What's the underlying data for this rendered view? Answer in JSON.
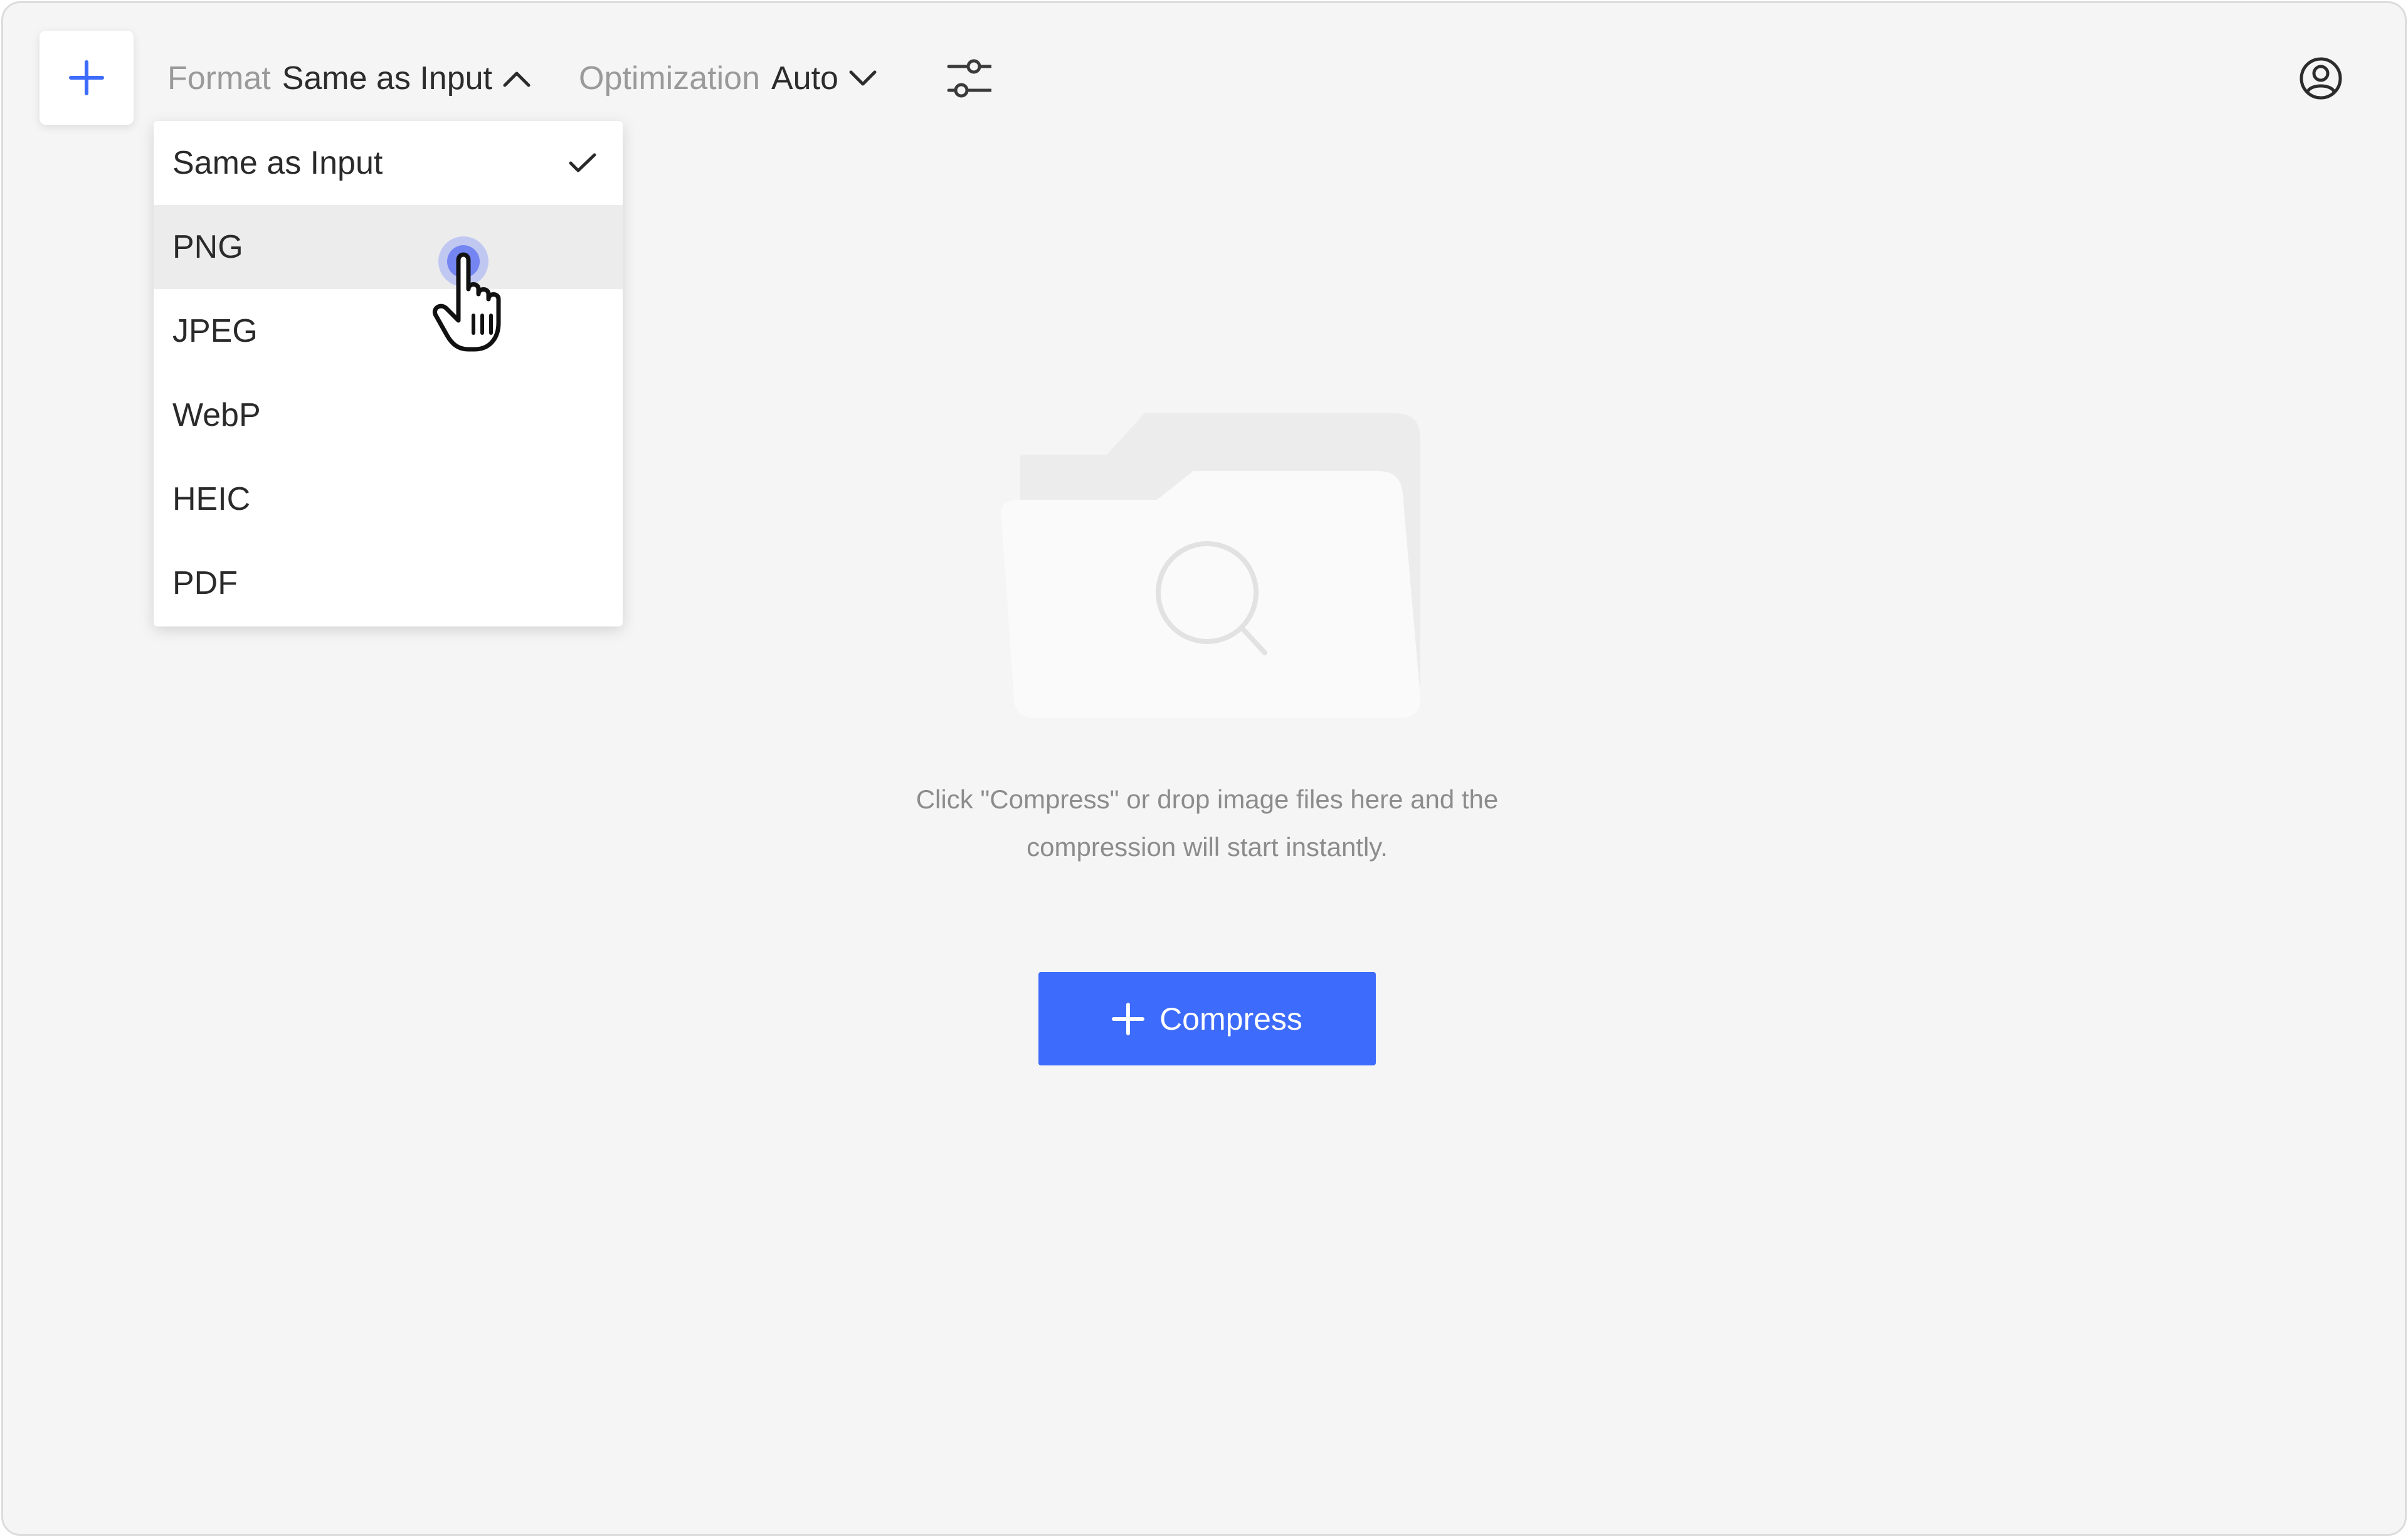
{
  "toolbar": {
    "add_icon": "plus-icon",
    "format": {
      "label": "Format",
      "value": "Same as Input",
      "icon": "chevron-up-icon",
      "expanded": true
    },
    "optimization": {
      "label": "Optimization",
      "value": "Auto",
      "icon": "chevron-down-icon"
    },
    "settings_icon": "sliders-icon",
    "account_icon": "user-circle-icon"
  },
  "format_menu": {
    "selected": "Same as Input",
    "hovered": "PNG",
    "items": [
      {
        "label": "Same as Input",
        "checked": true
      },
      {
        "label": "PNG"
      },
      {
        "label": "JPEG"
      },
      {
        "label": "WebP"
      },
      {
        "label": "HEIC"
      },
      {
        "label": "PDF"
      }
    ]
  },
  "empty_state": {
    "icon": "folder-search-icon",
    "line1": "Click \"Compress\" or drop image files here and the",
    "line2": "compression will start instantly."
  },
  "compress_button": {
    "label": "Compress",
    "icon": "plus-icon"
  },
  "colors": {
    "accent": "#3d6bfb",
    "background": "#f5f5f5",
    "menu_hover": "#ececec"
  }
}
